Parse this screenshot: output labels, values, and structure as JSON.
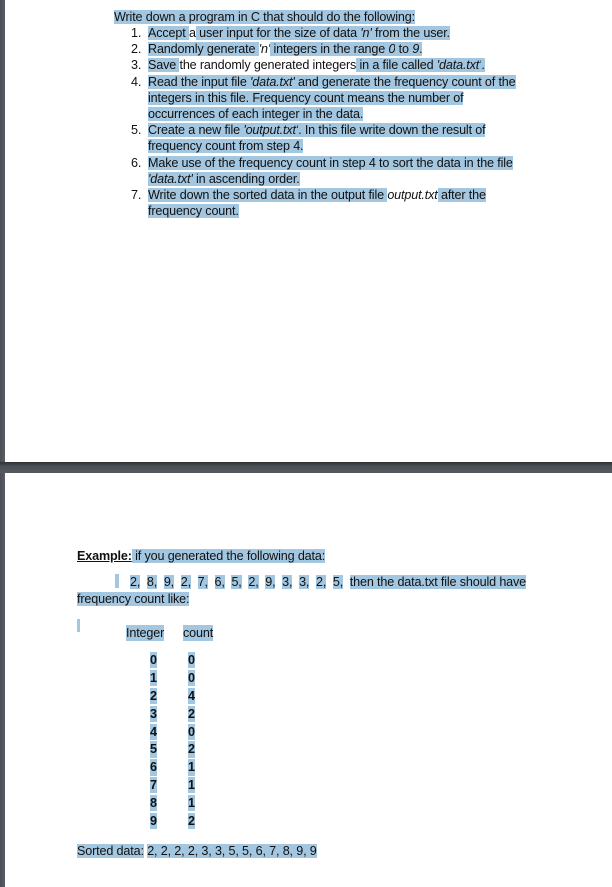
{
  "viewer": {
    "highlight_color": "#a3c6e1",
    "separator_color": "#4b5056"
  },
  "page1": {
    "intro": "Write down a program in C that should do the following:",
    "steps": [
      {
        "num": "1.",
        "lines": [
          [
            "Accept ",
            "a",
            " user input for the size of data ",
            "'n'",
            " from the user."
          ]
        ]
      },
      {
        "num": "2.",
        "lines": [
          [
            "Randomly generate ",
            "'n'",
            " integers in the range ",
            "0",
            " to ",
            "9",
            "."
          ]
        ]
      },
      {
        "num": "3.",
        "lines": [
          [
            "Save ",
            "the randomly generated integers",
            " in a file ",
            "called ",
            "'data.txt'",
            "."
          ]
        ]
      },
      {
        "num": "4.",
        "lines": [
          [
            "Read the ",
            "input file ",
            "'data.txt'",
            " and generate the frequency count of the"
          ],
          [
            "integers",
            " in this ",
            "file. Frequency count means the number of"
          ],
          [
            "occurrences",
            " of each integer in the data."
          ]
        ]
      },
      {
        "num": "5.",
        "lines": [
          [
            "Create a new file ",
            "'output.txt'",
            ". In this file write down the result of"
          ],
          [
            "frequency count from step 4."
          ]
        ]
      },
      {
        "num": "6.",
        "lines": [
          [
            "Make use of the frequency count in step 4 to sort",
            " the data in the file"
          ],
          [
            "'data.txt'",
            " in ",
            "ascending order."
          ]
        ]
      },
      {
        "num": "7.",
        "lines": [
          [
            "Write",
            " down ",
            "the sorted data in the output file ",
            "output.txt",
            " after the"
          ],
          [
            "frequency count."
          ]
        ]
      }
    ]
  },
  "page2": {
    "example_label": "Example:",
    "example_text": " if you generated the following data:",
    "data_values": [
      "2,",
      "8,",
      "9,",
      "2,",
      "7,",
      "6,",
      "5,",
      "2,",
      "9,",
      "3,",
      "3,",
      "2,",
      "5,"
    ],
    "data_then": "then",
    "data_rest": " the data.txt file should have",
    "data_line2": "frequency count like:",
    "table": {
      "headers": [
        "Integer",
        "count"
      ],
      "rows": [
        {
          "integer": "0",
          "count": "0"
        },
        {
          "integer": "1",
          "count": "0"
        },
        {
          "integer": "2",
          "count": "4"
        },
        {
          "integer": "3",
          "count": "2"
        },
        {
          "integer": "4",
          "count": "0"
        },
        {
          "integer": "5",
          "count": "2"
        },
        {
          "integer": "6",
          "count": "1"
        },
        {
          "integer": "7",
          "count": "1"
        },
        {
          "integer": "8",
          "count": "1"
        },
        {
          "integer": "9",
          "count": "2"
        }
      ]
    },
    "sorted_label": "Sorted data:",
    "sorted_values": "2, 2, 2, 2, 3, 3, 5, 5, 6, 7, 8, 9, 9"
  }
}
